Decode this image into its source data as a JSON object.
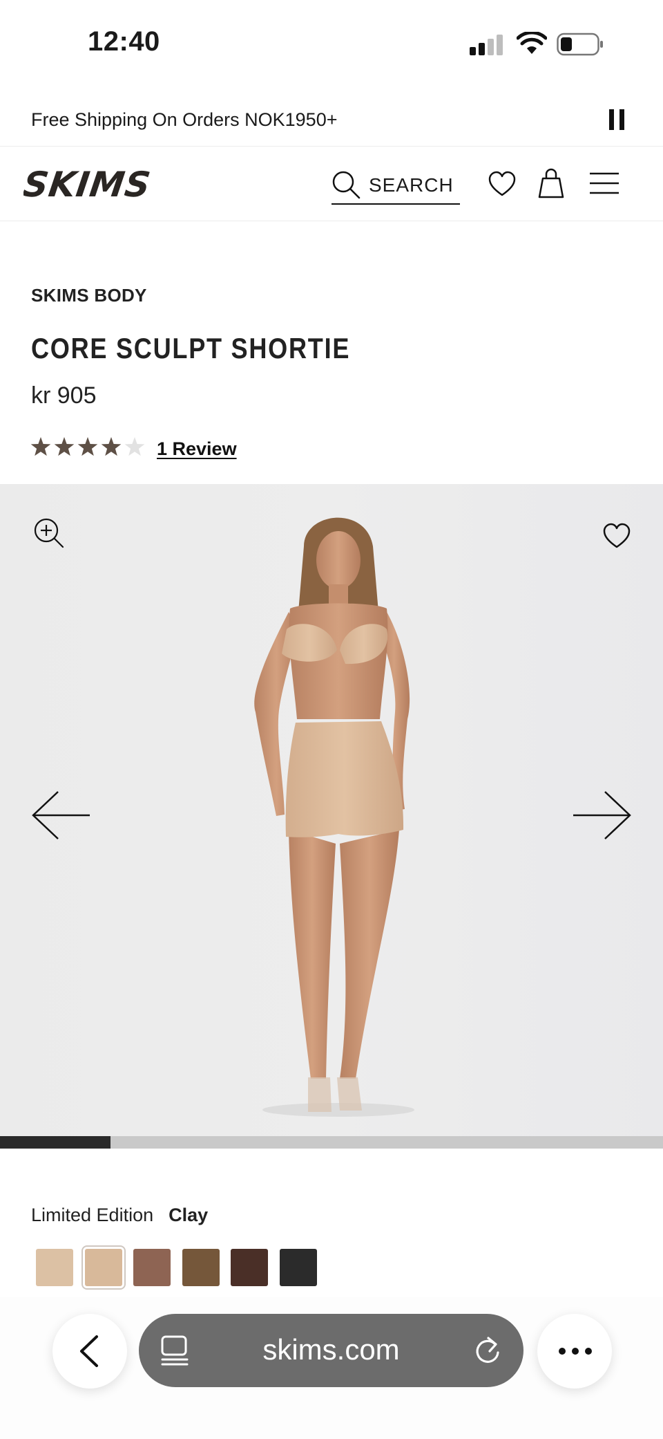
{
  "status_bar": {
    "time": "12:40"
  },
  "promo": {
    "text": "Free Shipping On Orders NOK1950+"
  },
  "header": {
    "logo": "SKIMS",
    "search_label": "SEARCH"
  },
  "product": {
    "brand": "SKIMS BODY",
    "title": "CORE SCULPT SHORTIE",
    "price": "kr 905",
    "rating": 4,
    "rating_max": 5,
    "review_link": "1 Review"
  },
  "gallery": {
    "progress": 0.167
  },
  "color": {
    "edition_label": "Limited Edition",
    "selected_name": "Clay",
    "swatches": [
      "#dcc1a4",
      "#d8b99a",
      "#8e6453",
      "#75573a",
      "#4a2f27",
      "#2b2b2b"
    ],
    "selected_index": 1
  },
  "browser": {
    "url": "skims.com"
  }
}
